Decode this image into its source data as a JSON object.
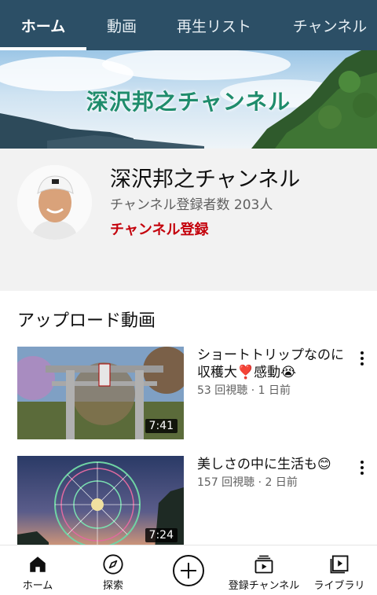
{
  "tabs": [
    {
      "label": "ホーム"
    },
    {
      "label": "動画"
    },
    {
      "label": "再生リスト"
    },
    {
      "label": "チャンネル"
    }
  ],
  "banner": {
    "title": "深沢邦之チャンネル"
  },
  "channel": {
    "name": "深沢邦之チャンネル",
    "subscribers": "チャンネル登録者数 203人",
    "subscribe_label": "チャンネル登録"
  },
  "uploads": {
    "section_title": "アップロード動画",
    "videos": [
      {
        "title": "ショートトリップなのに収穫大❣️感動😭",
        "meta": "53 回視聴 · 1 日前",
        "duration": "7:41"
      },
      {
        "title": "美しさの中に生活も😊",
        "meta": "157 回視聴 · 2 日前",
        "duration": "7:24"
      }
    ]
  },
  "bottom_nav": [
    {
      "label": "ホーム",
      "icon": "home-icon"
    },
    {
      "label": "探索",
      "icon": "compass-icon"
    },
    {
      "label": "",
      "icon": "create-icon"
    },
    {
      "label": "登録チャンネル",
      "icon": "subscriptions-icon"
    },
    {
      "label": "ライブラリ",
      "icon": "library-icon"
    }
  ],
  "colors": {
    "tab_bar": "#2c4f66",
    "subscribe": "#c4020c",
    "header_bg": "#f2f2f2"
  }
}
